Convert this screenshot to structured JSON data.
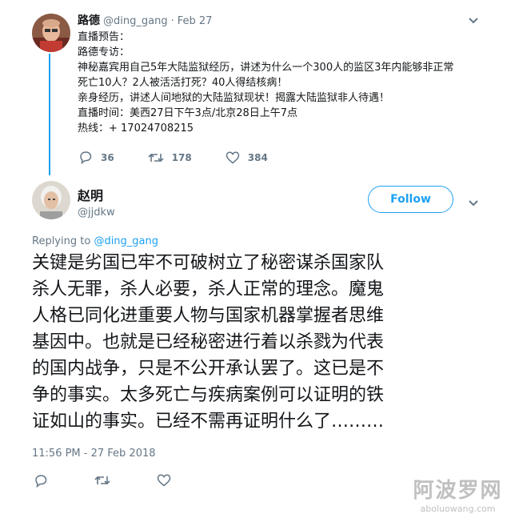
{
  "tweet1": {
    "author_name": "路德",
    "handle": "@ding_gang",
    "separator": "·",
    "date": "Feb 27",
    "lines": [
      "直播预告：",
      "路德专访：",
      "神秘嘉宾用自己5年大陆监狱经历，讲述为什么一个300人的监区3年内能够非正常",
      "死亡10人？2人被活活打死？40人得结核病！",
      "亲身经历，讲述人间地狱的大陆监狱现状！揭露大陆监狱非人待遇！",
      "直播时间：美西27日下午3点/北京28日上午7点",
      "热线：+ 17024708215"
    ],
    "replies": "36",
    "retweets": "178",
    "likes": "384"
  },
  "tweet2": {
    "author_name": "赵明",
    "handle": "@jjdkw",
    "follow_label": "Follow",
    "replying_prefix": "Replying to",
    "replying_to": "@ding_gang",
    "lines": [
      "关键是劣国已牢不可破树立了秘密谋杀国家队",
      "杀人无罪，杀人必要，杀人正常的理念。魔鬼",
      "人格已同化进重要人物与国家机器掌握者思维",
      "基因中。也就是已经秘密进行着以杀戮为代表",
      "的国内战争，只是不公开承认罢了。这已是不",
      "争的事实。太多死亡与疾病案例可以证明的铁",
      "证如山的事实。已经不需再证明什么了………"
    ],
    "timestamp": "11:56 PM - 27 Feb 2018"
  },
  "watermark": {
    "cn": "阿波罗网",
    "url": "aboluowang.com"
  },
  "icons": {
    "reply": "reply-icon",
    "retweet": "retweet-icon",
    "like": "heart-icon",
    "more": "chevron-down-icon"
  },
  "colors": {
    "accent": "#1da1f2",
    "muted": "#657786",
    "text": "#14171a"
  }
}
